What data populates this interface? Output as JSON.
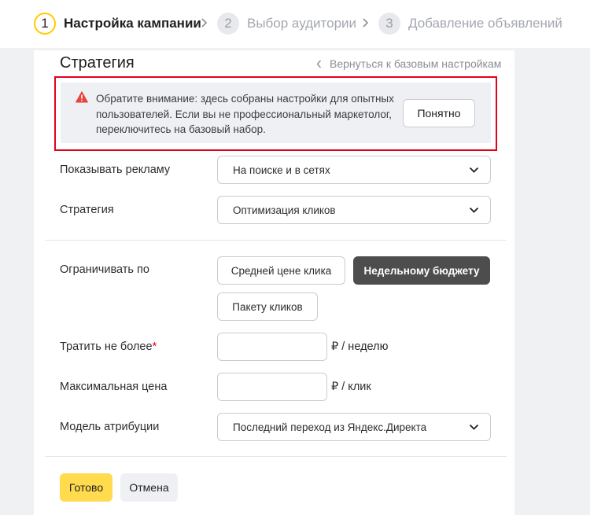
{
  "stepper": {
    "steps": [
      {
        "number": "1",
        "label": "Настройка кампании",
        "active": true
      },
      {
        "number": "2",
        "label": "Выбор аудитории",
        "active": false
      },
      {
        "number": "3",
        "label": "Добавление объявлений",
        "active": false
      }
    ]
  },
  "header": {
    "title": "Стратегия",
    "back_link": "Вернуться к базовым настройкам"
  },
  "notice": {
    "icon": "warning-icon",
    "text": "Обратите внимание: здесь собраны настройки для опытных пользователей. Если вы не профессиональный маркетолог, переключитесь на базовый набор.",
    "button": "Понятно"
  },
  "fields": {
    "show_ads": {
      "label": "Показывать рекламу",
      "value": "На поиске и в сетях"
    },
    "strategy": {
      "label": "Стратегия",
      "value": "Оптимизация кликов"
    },
    "limit_by": {
      "label": "Ограничивать по",
      "options": [
        "Средней цене клика",
        "Недельному бюджету",
        "Пакету кликов"
      ],
      "selected": "Недельному бюджету"
    },
    "spend_limit": {
      "label": "Тратить не более",
      "required_mark": "*",
      "value": "",
      "unit": "₽ / неделю"
    },
    "max_price": {
      "label": "Максимальная цена",
      "value": "",
      "unit": "₽ / клик"
    },
    "attribution": {
      "label": "Модель атрибуции",
      "value": "Последний переход из Яндекс.Директа"
    }
  },
  "actions": {
    "done": "Готово",
    "cancel": "Отмена"
  },
  "colors": {
    "accent_yellow": "#ffdb4d",
    "step_ring": "#ffcc00",
    "highlight_red": "#e3001b",
    "selected_dark": "#4d4d4d"
  }
}
